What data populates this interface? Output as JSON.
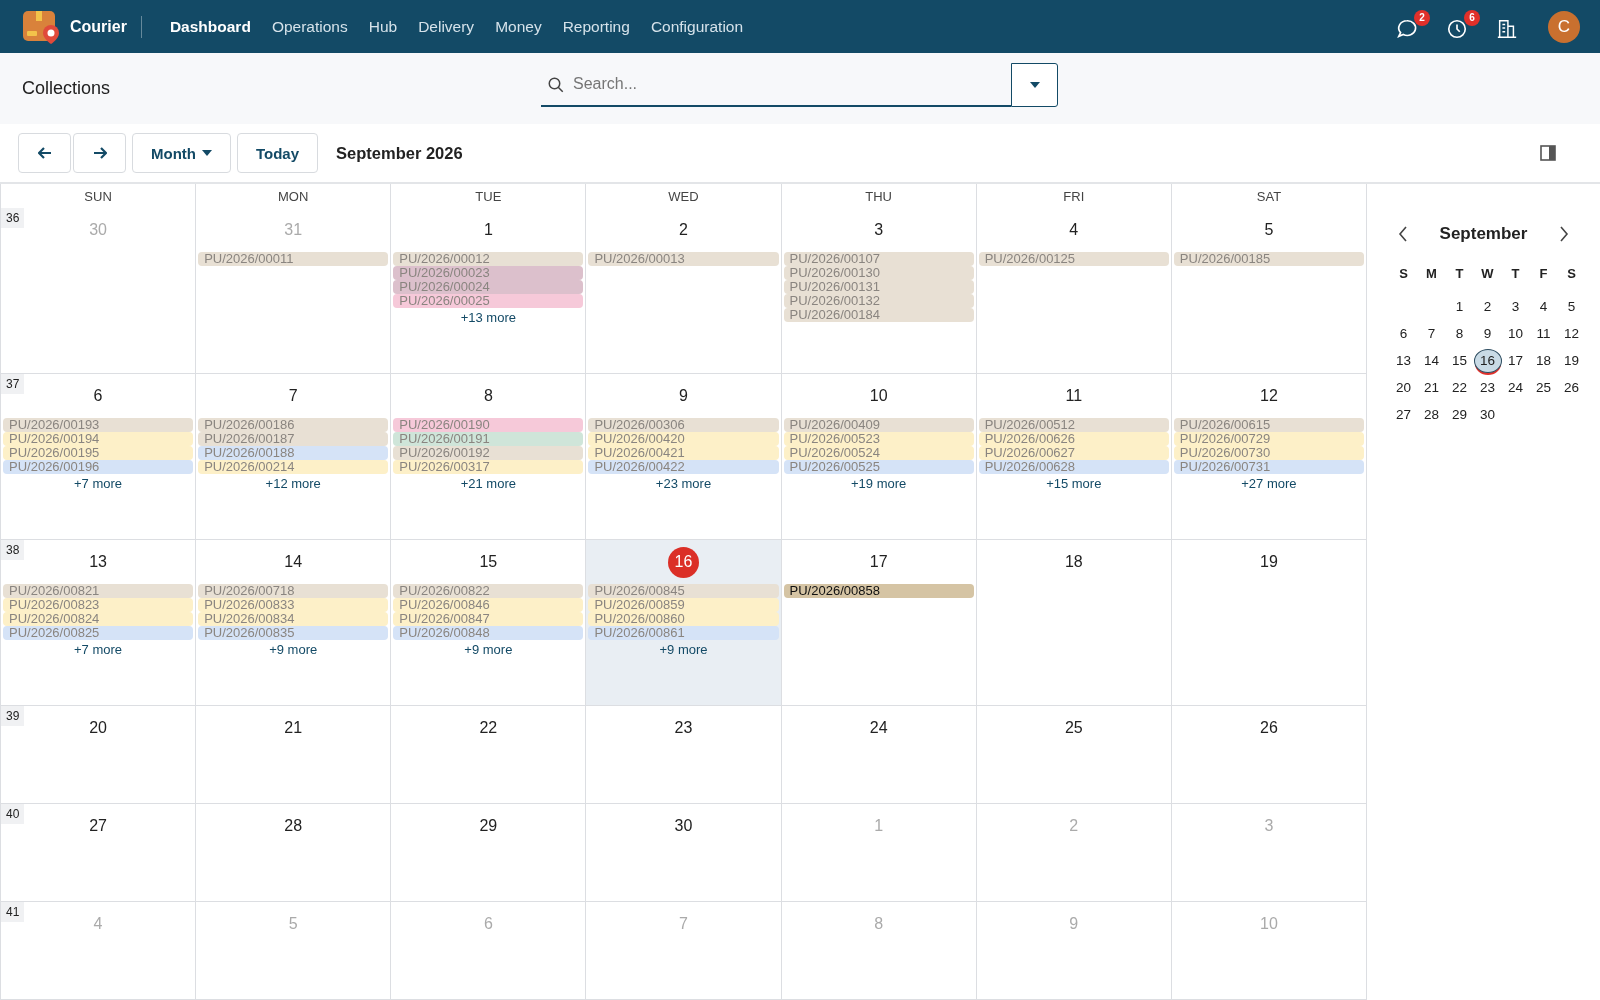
{
  "app": {
    "name": "Courier"
  },
  "nav": [
    {
      "label": "Dashboard",
      "selected": true
    },
    {
      "label": "Operations",
      "selected": false
    },
    {
      "label": "Hub",
      "selected": false
    },
    {
      "label": "Delivery",
      "selected": false
    },
    {
      "label": "Money",
      "selected": false
    },
    {
      "label": "Reporting",
      "selected": false
    },
    {
      "label": "Configuration",
      "selected": false
    }
  ],
  "header_icons": [
    {
      "kind": "chat",
      "badge": "2"
    },
    {
      "kind": "clock",
      "badge": "6"
    },
    {
      "kind": "building"
    }
  ],
  "avatar": {
    "initial": "C"
  },
  "page_title": "Collections",
  "search": {
    "placeholder": "Search..."
  },
  "toolbar": {
    "view": "Month",
    "today": "Today",
    "period": "September 2026"
  },
  "weekdays": [
    "SUN",
    "MON",
    "TUE",
    "WED",
    "THU",
    "FRI",
    "SAT"
  ],
  "weeks": [
    {
      "number": "36",
      "days": [
        {
          "day": "30",
          "other_month": true,
          "today": false
        },
        {
          "day": "31",
          "other_month": true,
          "today": false,
          "events": [
            {
              "label": "PU/2026/00011",
              "color": "#e8e0d4",
              "faded": true
            }
          ]
        },
        {
          "day": "1",
          "other_month": false,
          "today": false,
          "events": [
            {
              "label": "PU/2026/00012",
              "color": "#e8e0d4",
              "faded": true
            },
            {
              "label": "PU/2026/00023",
              "color": "#dcc0cc",
              "faded": true
            },
            {
              "label": "PU/2026/00024",
              "color": "#dcc0cc",
              "faded": true
            },
            {
              "label": "PU/2026/00025",
              "color": "#f6c9d9",
              "faded": true
            }
          ],
          "more": "+13 more"
        },
        {
          "day": "2",
          "other_month": false,
          "today": false,
          "events": [
            {
              "label": "PU/2026/00013",
              "color": "#e8e0d4",
              "faded": true
            }
          ]
        },
        {
          "day": "3",
          "other_month": false,
          "today": false,
          "events": [
            {
              "label": "PU/2026/00107",
              "color": "#e8e0d4",
              "faded": true
            },
            {
              "label": "PU/2026/00130",
              "color": "#e8e0d4",
              "faded": true
            },
            {
              "label": "PU/2026/00131",
              "color": "#e8e0d4",
              "faded": true
            },
            {
              "label": "PU/2026/00132",
              "color": "#e8e0d4",
              "faded": true
            },
            {
              "label": "PU/2026/00184",
              "color": "#e8e0d4",
              "faded": true
            }
          ]
        },
        {
          "day": "4",
          "other_month": false,
          "today": false,
          "events": [
            {
              "label": "PU/2026/00125",
              "color": "#e8e0d4",
              "faded": true
            }
          ]
        },
        {
          "day": "5",
          "other_month": false,
          "today": false,
          "events": [
            {
              "label": "PU/2026/00185",
              "color": "#e8e0d4",
              "faded": true
            }
          ]
        }
      ]
    },
    {
      "number": "37",
      "days": [
        {
          "day": "6",
          "other_month": false,
          "today": false,
          "events": [
            {
              "label": "PU/2026/00193",
              "color": "#e8e0d4",
              "faded": true
            },
            {
              "label": "PU/2026/00194",
              "color": "#fdf0c8",
              "faded": true
            },
            {
              "label": "PU/2026/00195",
              "color": "#fdf0c8",
              "faded": true
            },
            {
              "label": "PU/2026/00196",
              "color": "#d5e3f7",
              "faded": true
            }
          ],
          "more": "+7 more"
        },
        {
          "day": "7",
          "other_month": false,
          "today": false,
          "events": [
            {
              "label": "PU/2026/00186",
              "color": "#e8e0d4",
              "faded": true
            },
            {
              "label": "PU/2026/00187",
              "color": "#e8e0d4",
              "faded": true
            },
            {
              "label": "PU/2026/00188",
              "color": "#d5e3f7",
              "faded": true
            },
            {
              "label": "PU/2026/00214",
              "color": "#fdf0c8",
              "faded": true
            }
          ],
          "more": "+12 more"
        },
        {
          "day": "8",
          "other_month": false,
          "today": false,
          "events": [
            {
              "label": "PU/2026/00190",
              "color": "#f6c9d9",
              "faded": true
            },
            {
              "label": "PU/2026/00191",
              "color": "#cfe5d9",
              "faded": true
            },
            {
              "label": "PU/2026/00192",
              "color": "#e8e0d4",
              "faded": true
            },
            {
              "label": "PU/2026/00317",
              "color": "#fdf0c8",
              "faded": true
            }
          ],
          "more": "+21 more"
        },
        {
          "day": "9",
          "other_month": false,
          "today": false,
          "events": [
            {
              "label": "PU/2026/00306",
              "color": "#e8e0d4",
              "faded": true
            },
            {
              "label": "PU/2026/00420",
              "color": "#fdf0c8",
              "faded": true
            },
            {
              "label": "PU/2026/00421",
              "color": "#fdf0c8",
              "faded": true
            },
            {
              "label": "PU/2026/00422",
              "color": "#d5e3f7",
              "faded": true
            }
          ],
          "more": "+23 more"
        },
        {
          "day": "10",
          "other_month": false,
          "today": false,
          "events": [
            {
              "label": "PU/2026/00409",
              "color": "#e8e0d4",
              "faded": true
            },
            {
              "label": "PU/2026/00523",
              "color": "#fdf0c8",
              "faded": true
            },
            {
              "label": "PU/2026/00524",
              "color": "#fdf0c8",
              "faded": true
            },
            {
              "label": "PU/2026/00525",
              "color": "#d5e3f7",
              "faded": true
            }
          ],
          "more": "+19 more"
        },
        {
          "day": "11",
          "other_month": false,
          "today": false,
          "events": [
            {
              "label": "PU/2026/00512",
              "color": "#e8e0d4",
              "faded": true
            },
            {
              "label": "PU/2026/00626",
              "color": "#fdf0c8",
              "faded": true
            },
            {
              "label": "PU/2026/00627",
              "color": "#fdf0c8",
              "faded": true
            },
            {
              "label": "PU/2026/00628",
              "color": "#d5e3f7",
              "faded": true
            }
          ],
          "more": "+15 more"
        },
        {
          "day": "12",
          "other_month": false,
          "today": false,
          "events": [
            {
              "label": "PU/2026/00615",
              "color": "#e8e0d4",
              "faded": true
            },
            {
              "label": "PU/2026/00729",
              "color": "#fdf0c8",
              "faded": true
            },
            {
              "label": "PU/2026/00730",
              "color": "#fdf0c8",
              "faded": true
            },
            {
              "label": "PU/2026/00731",
              "color": "#d5e3f7",
              "faded": true
            }
          ],
          "more": "+27 more"
        }
      ]
    },
    {
      "number": "38",
      "days": [
        {
          "day": "13",
          "other_month": false,
          "today": false,
          "events": [
            {
              "label": "PU/2026/00821",
              "color": "#e8e0d4",
              "faded": true
            },
            {
              "label": "PU/2026/00823",
              "color": "#fdf0c8",
              "faded": true
            },
            {
              "label": "PU/2026/00824",
              "color": "#fdf0c8",
              "faded": true
            },
            {
              "label": "PU/2026/00825",
              "color": "#d5e3f7",
              "faded": true
            }
          ],
          "more": "+7 more"
        },
        {
          "day": "14",
          "other_month": false,
          "today": false,
          "events": [
            {
              "label": "PU/2026/00718",
              "color": "#e8e0d4",
              "faded": true
            },
            {
              "label": "PU/2026/00833",
              "color": "#fdf0c8",
              "faded": true
            },
            {
              "label": "PU/2026/00834",
              "color": "#fdf0c8",
              "faded": true
            },
            {
              "label": "PU/2026/00835",
              "color": "#d5e3f7",
              "faded": true
            }
          ],
          "more": "+9 more"
        },
        {
          "day": "15",
          "other_month": false,
          "today": false,
          "events": [
            {
              "label": "PU/2026/00822",
              "color": "#e8e0d4",
              "faded": true
            },
            {
              "label": "PU/2026/00846",
              "color": "#fdf0c8",
              "faded": true
            },
            {
              "label": "PU/2026/00847",
              "color": "#fdf0c8",
              "faded": true
            },
            {
              "label": "PU/2026/00848",
              "color": "#d5e3f7",
              "faded": true
            }
          ],
          "more": "+9 more"
        },
        {
          "day": "16",
          "other_month": false,
          "today": true,
          "events": [
            {
              "label": "PU/2026/00845",
              "color": "#e8e0d4",
              "faded": true
            },
            {
              "label": "PU/2026/00859",
              "color": "#fdf0c8",
              "faded": true
            },
            {
              "label": "PU/2026/00860",
              "color": "#fdf0c8",
              "faded": true
            },
            {
              "label": "PU/2026/00861",
              "color": "#d5e3f7",
              "faded": true
            }
          ],
          "more": "+9 more"
        },
        {
          "day": "17",
          "other_month": false,
          "today": false,
          "events": [
            {
              "label": "PU/2026/00858",
              "color": "#d5c4a4",
              "faded": false
            }
          ]
        },
        {
          "day": "18",
          "other_month": false,
          "today": false
        },
        {
          "day": "19",
          "other_month": false,
          "today": false
        }
      ]
    },
    {
      "number": "39",
      "days": [
        {
          "day": "20",
          "other_month": false,
          "today": false
        },
        {
          "day": "21",
          "other_month": false,
          "today": false
        },
        {
          "day": "22",
          "other_month": false,
          "today": false
        },
        {
          "day": "23",
          "other_month": false,
          "today": false
        },
        {
          "day": "24",
          "other_month": false,
          "today": false
        },
        {
          "day": "25",
          "other_month": false,
          "today": false
        },
        {
          "day": "26",
          "other_month": false,
          "today": false
        }
      ]
    },
    {
      "number": "40",
      "days": [
        {
          "day": "27",
          "other_month": false,
          "today": false
        },
        {
          "day": "28",
          "other_month": false,
          "today": false
        },
        {
          "day": "29",
          "other_month": false,
          "today": false
        },
        {
          "day": "30",
          "other_month": false,
          "today": false
        },
        {
          "day": "1",
          "other_month": true,
          "today": false
        },
        {
          "day": "2",
          "other_month": true,
          "today": false
        },
        {
          "day": "3",
          "other_month": true,
          "today": false
        }
      ]
    },
    {
      "number": "41",
      "days": [
        {
          "day": "4",
          "other_month": true,
          "today": false
        },
        {
          "day": "5",
          "other_month": true,
          "today": false
        },
        {
          "day": "6",
          "other_month": true,
          "today": false
        },
        {
          "day": "7",
          "other_month": true,
          "today": false
        },
        {
          "day": "8",
          "other_month": true,
          "today": false
        },
        {
          "day": "9",
          "other_month": true,
          "today": false
        },
        {
          "day": "10",
          "other_month": true,
          "today": false
        }
      ]
    }
  ],
  "mini_calendar": {
    "month": "September",
    "weekdays": [
      "S",
      "M",
      "T",
      "W",
      "T",
      "F",
      "S"
    ],
    "weeks": [
      [
        {
          "day": "1",
          "selected": false,
          "today": false
        },
        {
          "day": "2",
          "selected": false,
          "today": false
        },
        {
          "day": "3",
          "selected": false,
          "today": false
        },
        {
          "day": "4",
          "selected": false,
          "today": false
        },
        {
          "day": "5",
          "selected": false,
          "today": false
        }
      ],
      [
        {
          "day": "6",
          "selected": false,
          "today": false
        },
        {
          "day": "7",
          "selected": false,
          "today": false
        },
        {
          "day": "8",
          "selected": false,
          "today": false
        },
        {
          "day": "9",
          "selected": false,
          "today": false
        },
        {
          "day": "10",
          "selected": false,
          "today": false
        },
        {
          "day": "11",
          "selected": false,
          "today": false
        },
        {
          "day": "12",
          "selected": false,
          "today": false
        }
      ],
      [
        {
          "day": "13",
          "selected": false,
          "today": false
        },
        {
          "day": "14",
          "selected": false,
          "today": false
        },
        {
          "day": "15",
          "selected": false,
          "today": false
        },
        {
          "day": "16",
          "selected": true,
          "today": true
        },
        {
          "day": "17",
          "selected": false,
          "today": false
        },
        {
          "day": "18",
          "selected": false,
          "today": false
        },
        {
          "day": "19",
          "selected": false,
          "today": false
        }
      ],
      [
        {
          "day": "20",
          "selected": false,
          "today": false
        },
        {
          "day": "21",
          "selected": false,
          "today": false
        },
        {
          "day": "22",
          "selected": false,
          "today": false
        },
        {
          "day": "23",
          "selected": false,
          "today": false
        },
        {
          "day": "24",
          "selected": false,
          "today": false
        },
        {
          "day": "25",
          "selected": false,
          "today": false
        },
        {
          "day": "26",
          "selected": false,
          "today": false
        }
      ],
      [
        {
          "day": "27",
          "selected": false,
          "today": false
        },
        {
          "day": "28",
          "selected": false,
          "today": false
        },
        {
          "day": "29",
          "selected": false,
          "today": false
        },
        {
          "day": "30",
          "selected": false,
          "today": false
        }
      ]
    ]
  }
}
